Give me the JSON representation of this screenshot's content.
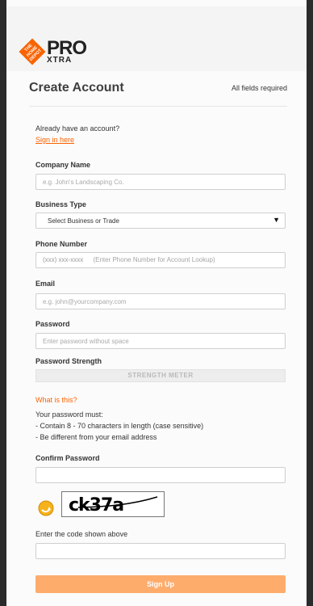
{
  "header": {
    "logo_square_text": "THE HOME DEPOT",
    "logo_pro": "PRO",
    "logo_xtra": "XTRA"
  },
  "form": {
    "title": "Create Account",
    "required_note": "All fields required",
    "account_prompt": "Already have an account?",
    "sign_in_link": "Sign in here",
    "company_label": "Company Name",
    "company_placeholder": "e.g. John's Landscaping Co.",
    "business_label": "Business Type",
    "business_value": "Select Business or Trade",
    "phone_label": "Phone Number",
    "phone_placeholder": "(xxx) xxx-xxxx",
    "phone_hint": "(Enter Phone Number for Account Lookup)",
    "email_label": "Email",
    "email_placeholder": "e.g. john@yourcompany.com",
    "password_label": "Password",
    "password_placeholder": "Enter password without space",
    "strength_label": "Password Strength",
    "strength_meter": "STRENGTH METER",
    "what_is_this": "What is this?",
    "rules_heading": "Your password must:",
    "rule_1": "- Contain 8 - 70 characters in length (case sensitive)",
    "rule_2": "- Be different from your email address",
    "confirm_label": "Confirm Password",
    "captcha_text": "ck37a",
    "captcha_label": "Enter the code shown above",
    "signup_button": "Sign Up"
  },
  "colors": {
    "brand_orange": "#f96302",
    "button_orange": "#fdac6c"
  }
}
